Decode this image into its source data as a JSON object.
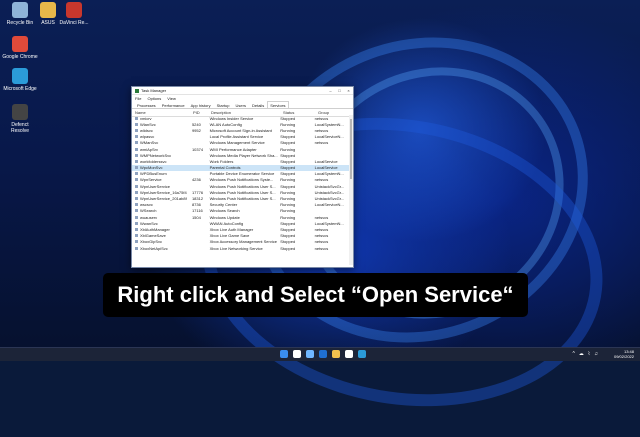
{
  "desktop": {
    "icons": [
      {
        "label": "Recycle Bin",
        "color": "#8fb4d8"
      },
      {
        "label": "ASUS",
        "color": "#e8b84a"
      },
      {
        "label": "DaVinci Re...",
        "color": "#c8372d"
      },
      {
        "label": "Google Chrome",
        "color": "#e04a3a"
      },
      {
        "label": "Microsoft Edge",
        "color": "#2b9bd9"
      },
      {
        "label": "Defenct Resolve",
        "color": "#444"
      }
    ]
  },
  "task_manager": {
    "title": "Task Manager",
    "menu": [
      "File",
      "Options",
      "View"
    ],
    "tabs": [
      "Processes",
      "Performance",
      "App history",
      "Startup",
      "Users",
      "Details",
      "Services"
    ],
    "active_tab": "Services",
    "columns": [
      "Name",
      "PID",
      "Description",
      "Status",
      "Group"
    ],
    "rows": [
      {
        "name": "vmicrv",
        "pid": "",
        "desc": "Windows Insider Service",
        "status": "Stopped",
        "group": "netsvcs"
      },
      {
        "name": "WlanSvc",
        "pid": "5240",
        "desc": "WLAN AutoConfig",
        "status": "Running",
        "group": "LocalSystemN..."
      },
      {
        "name": "wlidsvc",
        "pid": "9952",
        "desc": "Microsoft Account Sign-in Assistant",
        "status": "Running",
        "group": "netsvcs"
      },
      {
        "name": "wlpasvc",
        "pid": "",
        "desc": "Local Profile Assistant Service",
        "status": "Stopped",
        "group": "LocalServiceN..."
      },
      {
        "name": "WManSvc",
        "pid": "",
        "desc": "Windows Management Service",
        "status": "Stopped",
        "group": "netsvcs"
      },
      {
        "name": "wmiApSrv",
        "pid": "10374",
        "desc": "WMI Performance Adapter",
        "status": "Running",
        "group": ""
      },
      {
        "name": "WMPNetworkSvc",
        "pid": "",
        "desc": "Windows Media Player Network Sha...",
        "status": "Stopped",
        "group": ""
      },
      {
        "name": "workfolderssvc",
        "pid": "",
        "desc": "Work Folders",
        "status": "Stopped",
        "group": "LocalService"
      },
      {
        "name": "WpcMonSvc",
        "pid": "",
        "desc": "Parental Controls",
        "status": "Stopped",
        "group": "LocalService"
      },
      {
        "name": "WPDBusEnum",
        "pid": "",
        "desc": "Portable Device Enumerator Service",
        "status": "Stopped",
        "group": "LocalSystemN..."
      },
      {
        "name": "WpnService",
        "pid": "4236",
        "desc": "Windows Push Notifications Syste...",
        "status": "Running",
        "group": "netsvcs"
      },
      {
        "name": "WpnUserService",
        "pid": "",
        "desc": "Windows Push Notifications User S...",
        "status": "Stopped",
        "group": "UnistackSvcGr..."
      },
      {
        "name": "WpnUserService_16a75f4",
        "pid": "17776",
        "desc": "Windows Push Notifications User S...",
        "status": "Running",
        "group": "UnistackSvcGr..."
      },
      {
        "name": "WpnUserService_201ab8f",
        "pid": "18312",
        "desc": "Windows Push Notifications User S...",
        "status": "Running",
        "group": "UnistackSvcGr..."
      },
      {
        "name": "wscsvc",
        "pid": "8736",
        "desc": "Security Center",
        "status": "Running",
        "group": "LocalServiceN..."
      },
      {
        "name": "WSearch",
        "pid": "17116",
        "desc": "Windows Search",
        "status": "Running",
        "group": ""
      },
      {
        "name": "wuauserv",
        "pid": "1504",
        "desc": "Windows Update",
        "status": "Running",
        "group": "netsvcs"
      },
      {
        "name": "WwanSvc",
        "pid": "",
        "desc": "WWAN AutoConfig",
        "status": "Stopped",
        "group": "LocalSystemN..."
      },
      {
        "name": "XblAuthManager",
        "pid": "",
        "desc": "Xbox Live Auth Manager",
        "status": "Stopped",
        "group": "netsvcs"
      },
      {
        "name": "XblGameSave",
        "pid": "",
        "desc": "Xbox Live Game Save",
        "status": "Stopped",
        "group": "netsvcs"
      },
      {
        "name": "XboxGipSvc",
        "pid": "",
        "desc": "Xbox Accessory Management Service",
        "status": "Stopped",
        "group": "netsvcs"
      },
      {
        "name": "XboxNetApiSvc",
        "pid": "",
        "desc": "Xbox Live Networking Service",
        "status": "Stopped",
        "group": "netsvcs"
      }
    ],
    "selected_row": 8
  },
  "caption": "Right click and Select “Open Service“",
  "taskbar": {
    "time": "13:48",
    "date": "09/02/2022",
    "tray": [
      "^",
      "☁",
      "⌇",
      "♫"
    ],
    "icon_colors": [
      "#3a8ef0",
      "#ffffff",
      "#6fb6ff",
      "#1f6fd1",
      "#f2c14e",
      "#ffffff",
      "#2b9bd9"
    ]
  }
}
